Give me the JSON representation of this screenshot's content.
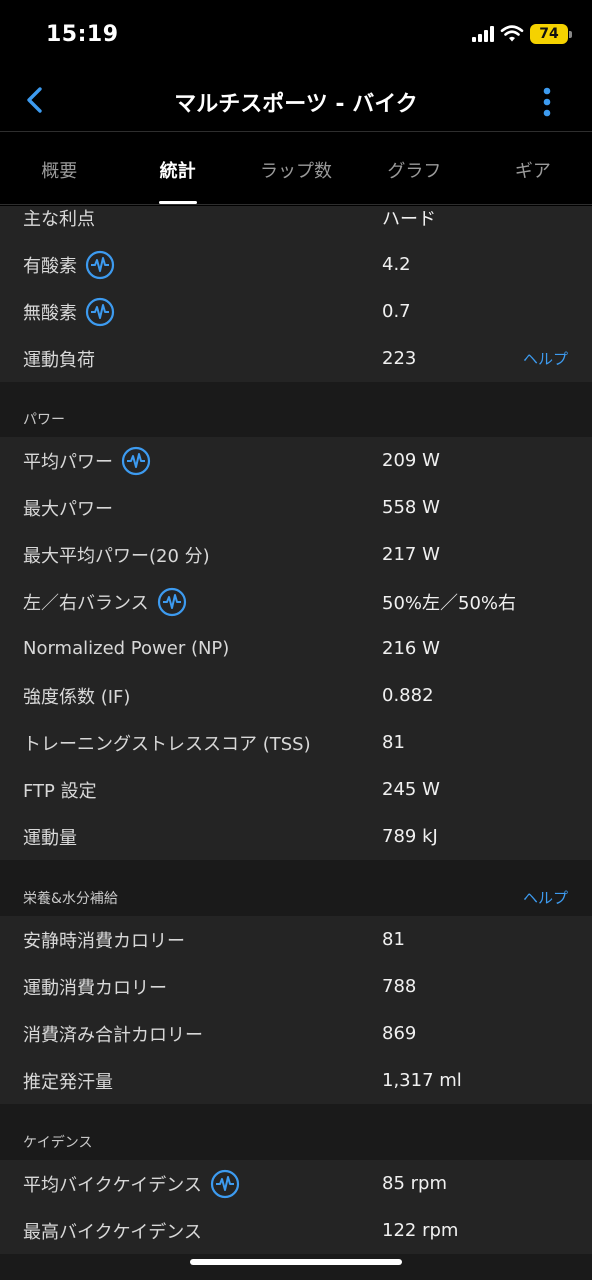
{
  "status_bar": {
    "time": "15:19",
    "battery": "74"
  },
  "nav": {
    "title": "マルチスポーツ - バイク",
    "back_icon": "chevron-left-icon",
    "more_icon": "vertical-ellipsis-icon"
  },
  "tabs": [
    {
      "label": "概要"
    },
    {
      "label": "統計"
    },
    {
      "label": "ラップ数"
    },
    {
      "label": "グラフ"
    },
    {
      "label": "ギア"
    }
  ],
  "training": {
    "rows": [
      {
        "label": "主な利点",
        "value": "ハード"
      },
      {
        "label": "有酸素",
        "value": "4.2"
      },
      {
        "label": "無酸素",
        "value": "0.7"
      },
      {
        "label": "運動負荷",
        "value": "223",
        "help": "ヘルプ"
      }
    ]
  },
  "power": {
    "title": "パワー",
    "rows": [
      {
        "label": "平均パワー",
        "value": "209 W"
      },
      {
        "label": "最大パワー",
        "value": "558 W"
      },
      {
        "label": "最大平均パワー(20 分)",
        "value": "217 W"
      },
      {
        "label": "左／右バランス",
        "value": "50%左／50%右"
      },
      {
        "label": "Normalized Power (NP)",
        "value": "216 W"
      },
      {
        "label": "強度係数 (IF)",
        "value": "0.882"
      },
      {
        "label": "トレーニングストレススコア (TSS)",
        "value": "81"
      },
      {
        "label": "FTP 設定",
        "value": "245 W"
      },
      {
        "label": "運動量",
        "value": "789 kJ"
      }
    ]
  },
  "nutrition": {
    "title": "栄養&水分補給",
    "help": "ヘルプ",
    "rows": [
      {
        "label": "安静時消費カロリー",
        "value": "81"
      },
      {
        "label": "運動消費カロリー",
        "value": "788"
      },
      {
        "label": "消費済み合計カロリー",
        "value": "869"
      },
      {
        "label": "推定発汗量",
        "value": "1,317 ml"
      }
    ]
  },
  "cadence": {
    "title": "ケイデンス",
    "rows": [
      {
        "label": "平均バイクケイデンス",
        "value": "85 rpm"
      },
      {
        "label": "最高バイクケイデンス",
        "value": "122 rpm"
      }
    ]
  },
  "colors": {
    "accent": "#3d9bf0",
    "row_bg": "#242424",
    "section_bg": "#1a1a1a",
    "battery": "#f5d200"
  }
}
